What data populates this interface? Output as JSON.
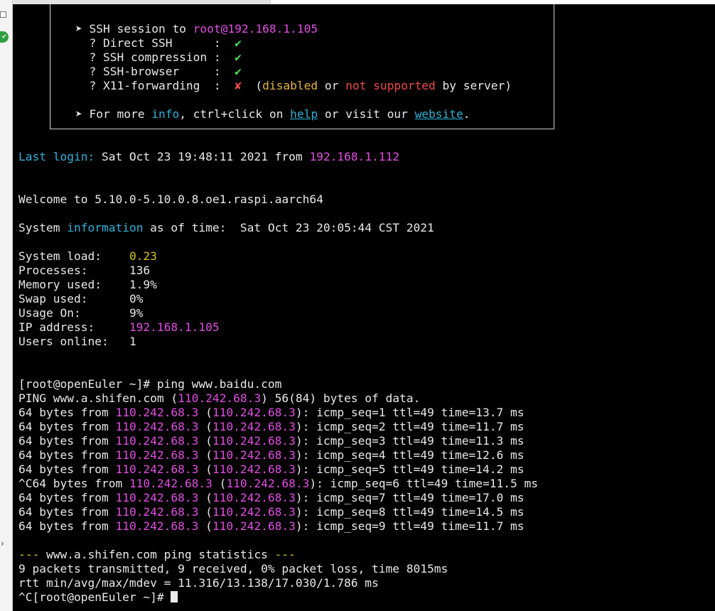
{
  "banner": {
    "ssh_session_prefix": "➤ SSH session to ",
    "ssh_session_target": "root@192.168.1.105",
    "direct_ssh_label": "  ? Direct SSH      :  ",
    "direct_ssh_status": "✔",
    "compression_label": "  ? SSH compression :  ",
    "compression_status": "✔",
    "browser_label": "  ? SSH-browser     :  ",
    "browser_status": "✔",
    "x11_label": "  ? X11-forwarding  :  ",
    "x11_status": "✘",
    "x11_paren_open": "  (",
    "x11_disabled": "disabled",
    "x11_or": " or ",
    "x11_not_supported": "not supported",
    "x11_tail": " by server)",
    "info_prefix": "➤ For more ",
    "info_word": "info",
    "info_mid": ", ctrl+click on ",
    "help_link": "help",
    "info_mid2": " or visit our ",
    "website_link": "website",
    "info_end": "."
  },
  "login": {
    "label": "Last login:",
    "text": " Sat Oct 23 19:48:11 2021 from ",
    "ip": "192.168.1.112"
  },
  "welcome": "Welcome to 5.10.0-5.10.0.8.oe1.raspi.aarch64",
  "sysinfo": {
    "prefix": "System ",
    "word": "information",
    "suffix": " as of time:  Sat Oct 23 20:05:44 CST 2021"
  },
  "stats": [
    {
      "label": "System load:    ",
      "value": "0.23",
      "color": "yellow"
    },
    {
      "label": "Processes:      ",
      "value": "136",
      "color": ""
    },
    {
      "label": "Memory used:    ",
      "value": "1.9%",
      "color": ""
    },
    {
      "label": "Swap used:      ",
      "value": "0%",
      "color": ""
    },
    {
      "label": "Usage On:       ",
      "value": "9%",
      "color": ""
    },
    {
      "label": "IP address:     ",
      "value": "192.168.1.105",
      "color": "magenta"
    },
    {
      "label": "Users online:   ",
      "value": "1",
      "color": ""
    }
  ],
  "prompt_command": "[root@openEuler ~]# ping www.baidu.com",
  "ping_header": {
    "prefix": "PING www.a.shifen.com (",
    "ip": "110.242.68.3",
    "suffix": ") 56(84) bytes of data."
  },
  "ping_ip": "110.242.68.3",
  "ping_replies": [
    {
      "lead": "64 bytes from ",
      "tail": "): icmp_seq=1 ttl=49 time=13.7 ms"
    },
    {
      "lead": "64 bytes from ",
      "tail": "): icmp_seq=2 ttl=49 time=11.7 ms"
    },
    {
      "lead": "64 bytes from ",
      "tail": "): icmp_seq=3 ttl=49 time=11.3 ms"
    },
    {
      "lead": "64 bytes from ",
      "tail": "): icmp_seq=4 ttl=49 time=12.6 ms"
    },
    {
      "lead": "64 bytes from ",
      "tail": "): icmp_seq=5 ttl=49 time=14.2 ms"
    },
    {
      "lead": "^C64 bytes from ",
      "tail": "): icmp_seq=6 ttl=49 time=11.5 ms"
    },
    {
      "lead": "64 bytes from ",
      "tail": "): icmp_seq=7 ttl=49 time=17.0 ms"
    },
    {
      "lead": "64 bytes from ",
      "tail": "): icmp_seq=8 ttl=49 time=14.5 ms"
    },
    {
      "lead": "64 bytes from ",
      "tail": "): icmp_seq=9 ttl=49 time=11.7 ms"
    }
  ],
  "statistics": {
    "dashes_left": "---",
    "host": " www.a.shifen.com ping statistics ",
    "dashes_right": "---",
    "transmitted": "9 packets transmitted, 9 received, 0% packet loss, time 8015ms",
    "rtt": "rtt min/avg/max/mdev = 11.316/13.138/17.030/1.786 ms"
  },
  "final_prompt": "^C[root@openEuler ~]# ",
  "colors": {
    "background": "#000000",
    "foreground": "#e9e9e9",
    "magenta": "#e24ee2",
    "cyan": "#2fb2d6",
    "green": "#52e052",
    "red": "#ef4a4a",
    "yellow": "#d6c11f",
    "orange": "#e8b341"
  }
}
